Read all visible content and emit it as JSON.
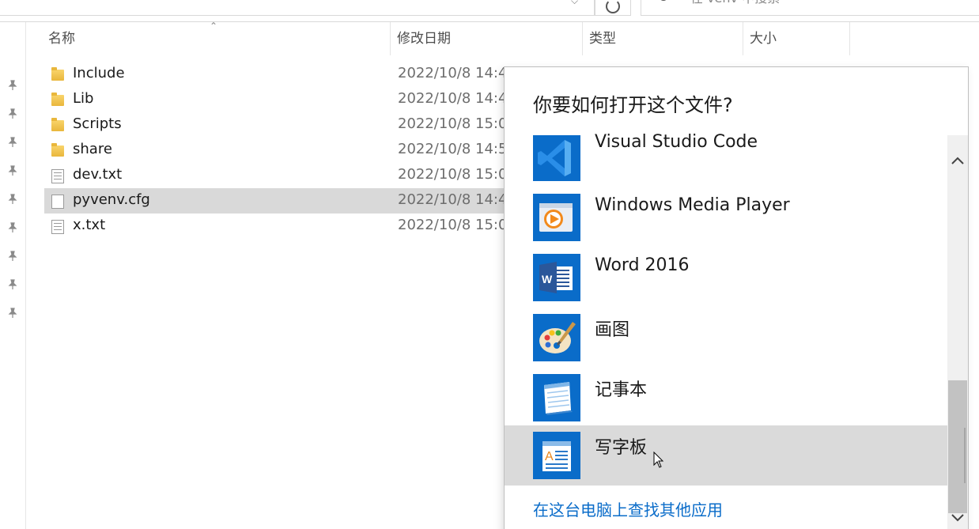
{
  "search": {
    "placeholder": "在 venv 中搜索"
  },
  "columns": [
    {
      "label": "名称"
    },
    {
      "label": "修改日期"
    },
    {
      "label": "类型"
    },
    {
      "label": "大小"
    }
  ],
  "files": [
    {
      "name": "Include",
      "date": "2022/10/8 14:4",
      "icon": "folder-icon"
    },
    {
      "name": "Lib",
      "date": "2022/10/8 14:4",
      "icon": "folder-icon"
    },
    {
      "name": "Scripts",
      "date": "2022/10/8 15:0",
      "icon": "folder-icon"
    },
    {
      "name": "share",
      "date": "2022/10/8 14:5",
      "icon": "folder-icon"
    },
    {
      "name": "dev.txt",
      "date": "2022/10/8 15:0",
      "icon": "text-file-icon"
    },
    {
      "name": "pyvenv.cfg",
      "date": "2022/10/8 14:4",
      "icon": "file-icon",
      "selected": true
    },
    {
      "name": "x.txt",
      "date": "2022/10/8 15:0",
      "icon": "text-file-icon"
    }
  ],
  "dialog": {
    "title": "你要如何打开这个文件?",
    "apps": [
      {
        "name": "Visual Studio Code",
        "icon": "vscode-icon"
      },
      {
        "name": "Windows Media Player",
        "icon": "media-player-icon"
      },
      {
        "name": "Word 2016",
        "icon": "word-icon"
      },
      {
        "name": "画图",
        "icon": "paint-icon"
      },
      {
        "name": "记事本",
        "icon": "notepad-icon"
      },
      {
        "name": "写字板",
        "icon": "wordpad-icon",
        "hovered": true
      }
    ],
    "find_more_link": "在这台电脑上查找其他应用"
  },
  "colors": {
    "accent": "#0a6cc9",
    "selected_row": "#d9d9d9",
    "hover_item": "#dadada"
  }
}
